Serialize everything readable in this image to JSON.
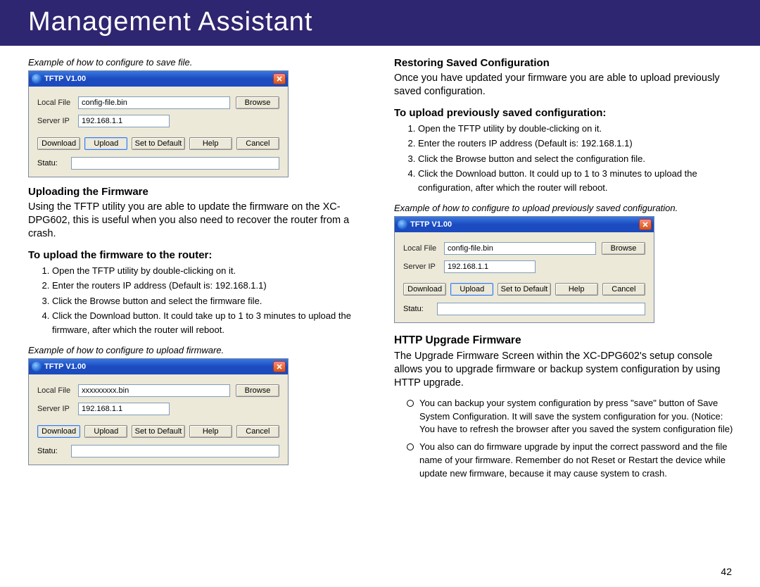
{
  "header": {
    "title": "Management Assistant"
  },
  "left": {
    "caption1": "Example of how to configure to save file.",
    "sec1_head": "Uploading the Firmware",
    "sec1_body": "Using the TFTP utility you are able to update the firmware on the XC-DPG602, this is useful when you also need to recover the router from a crash.",
    "sec2_head": "To upload the firmware to the router:",
    "steps": [
      "Open the TFTP utility by double-clicking on it.",
      "Enter the routers IP address (Default is: 192.168.1.1)",
      "Click the Browse button and select the firmware file.",
      "Click the Download button. It could take up to 1 to 3 minutes to upload the firmware, after which the router will reboot."
    ],
    "caption2": "Example of how to configure to upload firmware."
  },
  "right": {
    "sec1_head": "Restoring Saved Configuration",
    "sec1_body": "Once you have updated your firmware you are able to upload previously saved configuration.",
    "sec2_head": "To upload previously saved configuration:",
    "steps": [
      "Open the TFTP utility by double-clicking on it.",
      "Enter the routers IP address (Default is: 192.168.1.1)",
      "Click the Browse button and select the configuration file.",
      "Click the Download button. It could up to 1 to 3 minutes to upload the configuration, after which the router will reboot."
    ],
    "caption1": "Example of how to configure to upload previously saved configuration.",
    "sec3_head": "HTTP Upgrade Firmware",
    "sec3_body": "The Upgrade Firmware Screen within the XC-DPG602's setup console allows you to upgrade firmware or backup system configuration by using HTTP upgrade.",
    "bullets": [
      "You can backup your system configuration by press \"save\" button of Save System Configuration. It will save the system configuration for you. (Notice: You have to refresh the browser after you saved the system configuration file)",
      "You also can do firmware upgrade by input the correct password and the file name of your firmware. Remember do not Reset or Restart the device while update new firmware, because  it may cause system to crash."
    ]
  },
  "tftp": {
    "title": "TFTP V1.00",
    "label_localfile": "Local File",
    "label_serverip": "Server IP",
    "label_status": "Statu:",
    "btn_browse": "Browse",
    "btn_download": "Download",
    "btn_upload": "Upload",
    "btn_settodefault": "Set to Default",
    "btn_help": "Help",
    "btn_cancel": "Cancel",
    "win1": {
      "localfile": "config-file.bin",
      "serverip": "192.168.1.1",
      "selected": "upload"
    },
    "win2": {
      "localfile": "xxxxxxxxx.bin",
      "serverip": "192.168.1.1",
      "selected": "download"
    },
    "win3": {
      "localfile": "config-file.bin",
      "serverip": "192.168.1.1",
      "selected": "upload"
    }
  },
  "page_number": "42"
}
